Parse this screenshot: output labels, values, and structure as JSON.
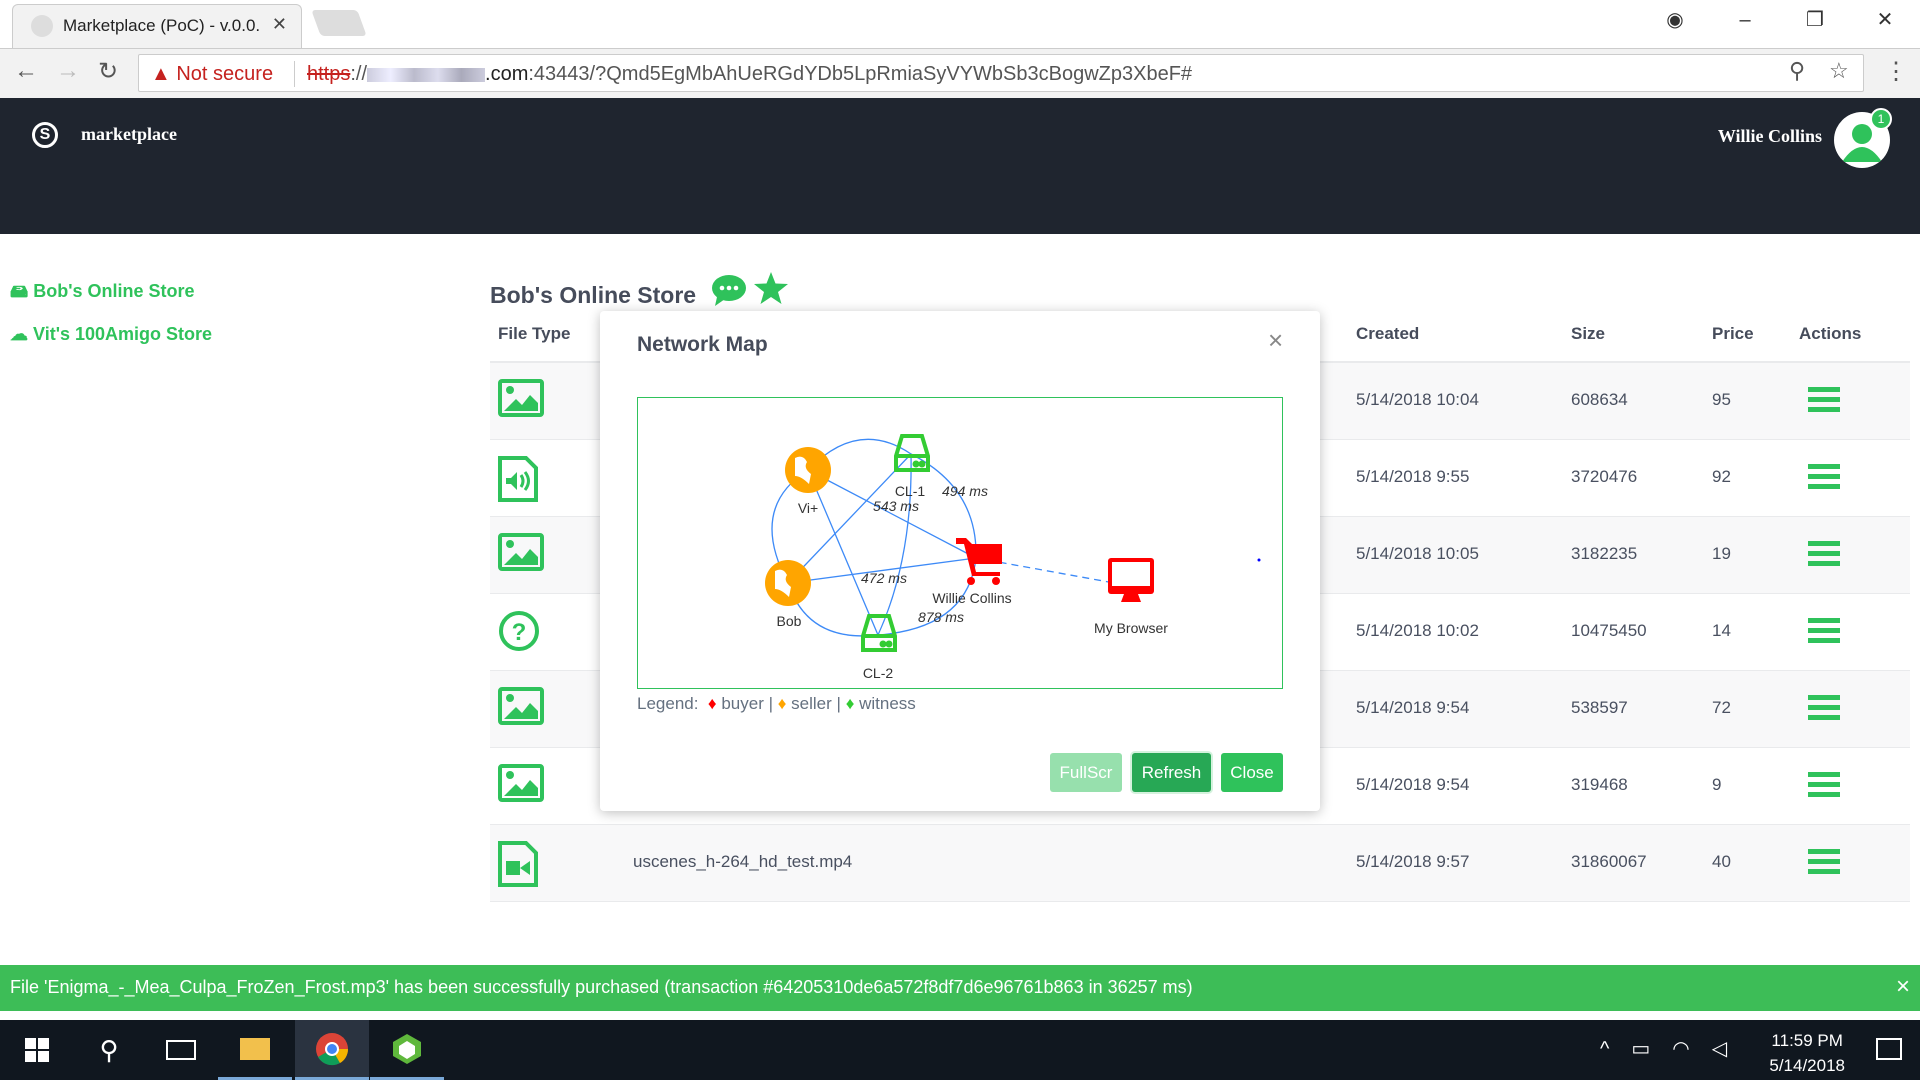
{
  "browser": {
    "tab_title": "Marketplace (PoC) - v.0.0.",
    "not_secure": "Not secure",
    "url_scheme": "https",
    "url_sep": "://",
    "url_domain": ".com",
    "url_rest": ":43443/?Qmd5EgMbAhUeRGdYDb5LpRmiaSyVYWbSb3cBogwZp3XbeF#"
  },
  "header": {
    "brand": "marketplace",
    "user": "Willie Collins",
    "notification_count": "1"
  },
  "sidebar": {
    "items": [
      {
        "label": "Bob's Online Store",
        "icon": "hdd-icon"
      },
      {
        "label": "Vit's 100Amigo Store",
        "icon": "cloud-icon"
      }
    ]
  },
  "store": {
    "title": "Bob's Online Store"
  },
  "table": {
    "headers": {
      "file_type": "File Type",
      "created": "Created",
      "size": "Size",
      "price": "Price",
      "actions": "Actions"
    },
    "rows": [
      {
        "type": "image",
        "name": "",
        "created": "5/14/2018 10:04",
        "size": "608634",
        "price": "95"
      },
      {
        "type": "audio",
        "name": "",
        "created": "5/14/2018 9:55",
        "size": "3720476",
        "price": "92"
      },
      {
        "type": "image",
        "name": "",
        "created": "5/14/2018 10:05",
        "size": "3182235",
        "price": "19"
      },
      {
        "type": "unknown",
        "name": "",
        "created": "5/14/2018 10:02",
        "size": "10475450",
        "price": "14"
      },
      {
        "type": "image",
        "name": "",
        "created": "5/14/2018 9:54",
        "size": "538597",
        "price": "72"
      },
      {
        "type": "image",
        "name": "",
        "created": "5/14/2018 9:54",
        "size": "319468",
        "price": "9"
      },
      {
        "type": "video",
        "name": "uscenes_h-264_hd_test.mp4",
        "created": "5/14/2018 9:57",
        "size": "31860067",
        "price": "40"
      }
    ]
  },
  "modal": {
    "title": "Network Map",
    "nodes": {
      "vi": "Vi+",
      "cl1": "CL-1",
      "bob": "Bob",
      "cl2": "CL-2",
      "willie": "Willie Collins",
      "browser": "My Browser"
    },
    "latencies": {
      "a": "494 ms",
      "b": "543 ms",
      "c": "472 ms",
      "d": "878 ms"
    },
    "legend": {
      "label": "Legend:",
      "buyer": "buyer",
      "seller": "seller",
      "witness": "witness",
      "sep": "|"
    },
    "colors": {
      "buyer": "#ff0000",
      "seller": "#ffa500",
      "witness": "#33cc33",
      "edge": "#3d8af7"
    },
    "buttons": {
      "fullscr": "FullScr",
      "refresh": "Refresh",
      "close": "Close"
    }
  },
  "toast": {
    "message": "File 'Enigma_-_Mea_Culpa_FroZen_Frost.mp3' has been successfully purchased (transaction #64205310de6a572f8df7d6e96761b863 in 36257 ms)"
  },
  "taskbar": {
    "time": "11:59 PM",
    "date": "5/14/2018"
  }
}
